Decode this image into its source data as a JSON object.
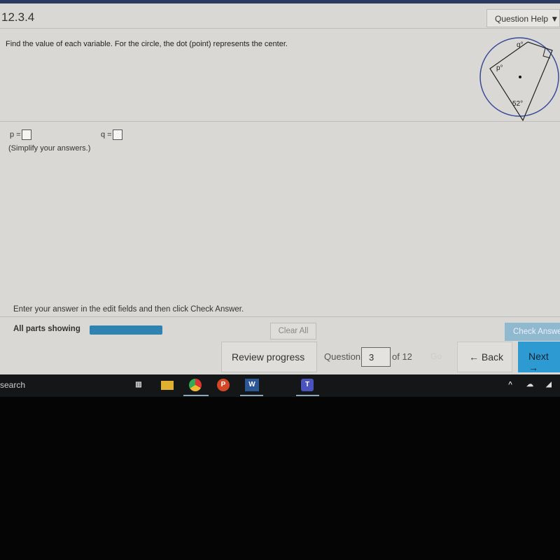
{
  "header": {
    "title": "12.3.4",
    "help_label": "Question Help ▼"
  },
  "question": {
    "text": "Find the value of each variable. For the circle, the dot (point) represents the center.",
    "figure": {
      "labels": [
        "q°",
        "p°",
        "52°"
      ],
      "circle_color": "#3a4a9a"
    }
  },
  "answers": {
    "p_label": "p =",
    "q_label": "q =",
    "p_value": "",
    "q_value": "",
    "hint": "(Simplify your answers.)"
  },
  "footer": {
    "instruction": "Enter your answer in the edit fields and then click Check Answer.",
    "all_parts": "All parts showing",
    "progress": 100,
    "clear_all": "Clear All",
    "check_answer": "Check Answer"
  },
  "nav": {
    "review": "Review progress",
    "question_label": "Question",
    "question_number": "3",
    "of": "of 12",
    "go": "Go",
    "back": "← Back",
    "next": "Next →"
  },
  "taskbar": {
    "search": "search",
    "apps": [
      "task-view",
      "file-explorer",
      "chrome",
      "powerpoint",
      "word",
      "teams"
    ]
  }
}
